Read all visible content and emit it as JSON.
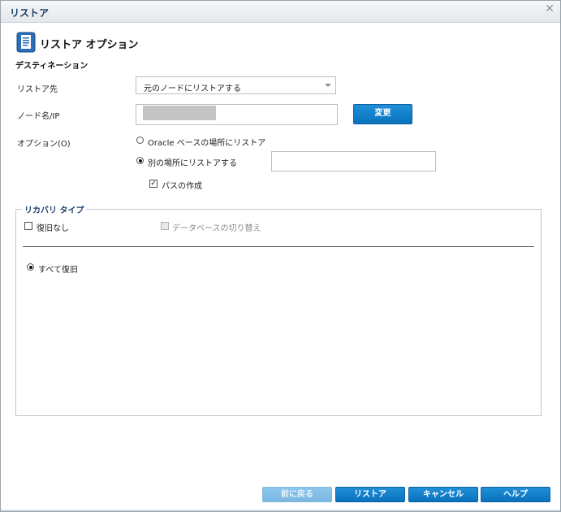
{
  "window": {
    "title": "リストア"
  },
  "header": {
    "title": "リストア オプション",
    "icon": "document-icon"
  },
  "destination": {
    "section_label": "デスティネーション",
    "restore_to": {
      "label": "リストア先",
      "selected": "元のノードにリストアする"
    },
    "node": {
      "label": "ノード名/IP",
      "value": "",
      "change_label": "変更"
    },
    "options": {
      "label": "オプション(O)",
      "oracle_base_label": "Oracle ベースの場所にリストア",
      "alternate_label": "別の場所にリストアする",
      "alternate_path": "",
      "create_path_label": "パスの作成",
      "selected": "alternate",
      "create_path_checked": true
    }
  },
  "recovery": {
    "legend": "リカバリ タイプ",
    "no_recovery_label": "復旧なし",
    "switch_db_label": "データベースの切り替え",
    "recover_all_label": "すべて復旧"
  },
  "footer": {
    "back_label": "前に戻る",
    "restore_label": "リストア",
    "cancel_label": "キャンセル",
    "help_label": "ヘルプ"
  },
  "colors": {
    "accent": "#0a72bd",
    "title": "#1b3b6a"
  }
}
